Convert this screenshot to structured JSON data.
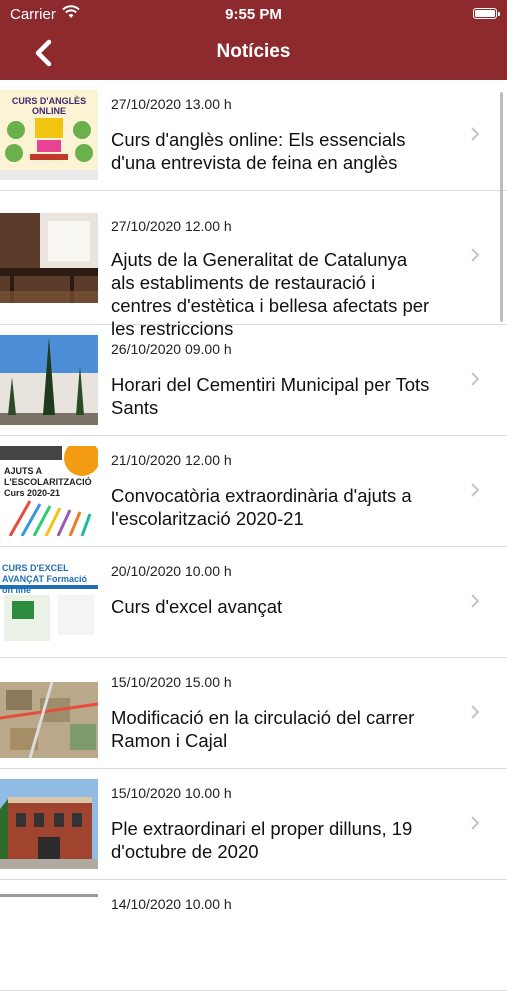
{
  "status_bar": {
    "carrier": "Carrier",
    "time": "9:55 PM"
  },
  "nav": {
    "title": "Notícies"
  },
  "news": [
    {
      "date": "27/10/2020 13.00 h",
      "title": "Curs d'anglès online: Els essencials d'una entrevista de feina en anglès",
      "thumb_text": "CURS D'ANGLÈS ONLINE"
    },
    {
      "date": "27/10/2020 12.00 h",
      "title": "Ajuts de la Generalitat de Catalunya als establiments de restauració i centres d'estètica i bellesa afectats per les restriccions"
    },
    {
      "date": "26/10/2020 09.00 h",
      "title": "Horari del Cementiri Municipal per Tots Sants"
    },
    {
      "date": "21/10/2020 12.00 h",
      "title": "Convocatòria extraordinària d'ajuts a l'escolarització 2020-21",
      "thumb_text": "AJUTS A L'ESCOLARITZACIÓ Curs 2020-21"
    },
    {
      "date": "20/10/2020 10.00 h",
      "title": "Curs d'excel avançat",
      "thumb_text": "CURS D'EXCEL AVANÇAT Formació on line"
    },
    {
      "date": "15/10/2020 15.00 h",
      "title": "Modificació en la circulació del carrer Ramon i Cajal"
    },
    {
      "date": "15/10/2020 10.00 h",
      "title": "Ple extraordinari el proper dilluns, 19 d'octubre de 2020"
    },
    {
      "date": "14/10/2020 10.00 h",
      "title": ""
    }
  ]
}
